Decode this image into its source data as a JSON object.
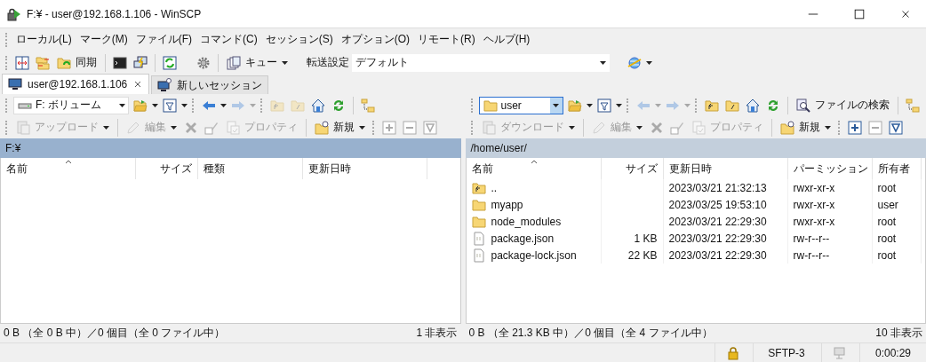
{
  "window": {
    "title": "F:¥ - user@192.168.1.106 - WinSCP"
  },
  "menu": [
    "ローカル(L)",
    "マーク(M)",
    "ファイル(F)",
    "コマンド(C)",
    "セッション(S)",
    "オプション(O)",
    "リモート(R)",
    "ヘルプ(H)"
  ],
  "toolbar": {
    "sync_label": "同期",
    "queue_label": "キュー",
    "transfer_label": "転送設定",
    "transfer_value": "デフォルト"
  },
  "session_tabs": [
    {
      "label": "user@192.168.1.106",
      "selected": true,
      "closable": true
    },
    {
      "label": "新しいセッション",
      "selected": false,
      "closable": false
    }
  ],
  "panels": [
    {
      "location": {
        "kind": "drive",
        "value": "F: ボリューム",
        "focused": false
      },
      "nav_disabled": {
        "back": false,
        "forward": true,
        "parent": true,
        "root": true
      },
      "transfer": {
        "label": "アップロード",
        "disabled": true
      },
      "edit": {
        "label": "編集",
        "disabled": true
      },
      "properties": {
        "label": "プロパティ",
        "disabled": true
      },
      "new": {
        "label": "新規",
        "disabled": false
      },
      "mark_buttons": [
        {
          "kind": "plus",
          "disabled": true
        },
        {
          "kind": "minus",
          "disabled": true
        },
        {
          "kind": "filter",
          "disabled": true
        }
      ],
      "path": "F:¥",
      "active": true,
      "columns": [
        "名前",
        "サイズ",
        "種類",
        "更新日時"
      ],
      "status": "0 B （全 0 B 中）／0 個目（全 0 ファイル中）",
      "hidden_count": "1 非表示"
    },
    {
      "location": {
        "kind": "folder",
        "value": "user",
        "focused": true
      },
      "nav_disabled": {
        "back": true,
        "forward": true,
        "parent": false,
        "root": false
      },
      "find_label": "ファイルの検索",
      "transfer": {
        "label": "ダウンロード",
        "disabled": true
      },
      "edit": {
        "label": "編集",
        "disabled": true
      },
      "properties": {
        "label": "プロパティ",
        "disabled": true
      },
      "new": {
        "label": "新規",
        "disabled": false
      },
      "mark_buttons": [
        {
          "kind": "plus",
          "disabled": false
        },
        {
          "kind": "minus",
          "disabled": true
        },
        {
          "kind": "filter",
          "disabled": false
        }
      ],
      "path": "/home/user/",
      "active": false,
      "columns": [
        "名前",
        "サイズ",
        "更新日時",
        "パーミッション",
        "所有者"
      ],
      "rows": [
        {
          "kind": "parent",
          "cells": [
            "..",
            "",
            "2023/03/21 21:32:13",
            "rwxr-xr-x",
            "root"
          ]
        },
        {
          "kind": "folder",
          "cells": [
            "myapp",
            "",
            "2023/03/25 19:53:10",
            "rwxr-xr-x",
            "user"
          ]
        },
        {
          "kind": "folder",
          "cells": [
            "node_modules",
            "",
            "2023/03/21 22:29:30",
            "rwxr-xr-x",
            "root"
          ]
        },
        {
          "kind": "file",
          "cells": [
            "package.json",
            "1 KB",
            "2023/03/21 22:29:30",
            "rw-r--r--",
            "root"
          ]
        },
        {
          "kind": "file",
          "cells": [
            "package-lock.json",
            "22 KB",
            "2023/03/21 22:29:30",
            "rw-r--r--",
            "root"
          ]
        }
      ],
      "status": "0 B （全 21.3 KB 中）／0 個目（全 4 ファイル中）",
      "hidden_count": "10 非表示"
    }
  ],
  "status_bar": {
    "protocol": "SFTP-3",
    "elapsed": "0:00:29"
  }
}
